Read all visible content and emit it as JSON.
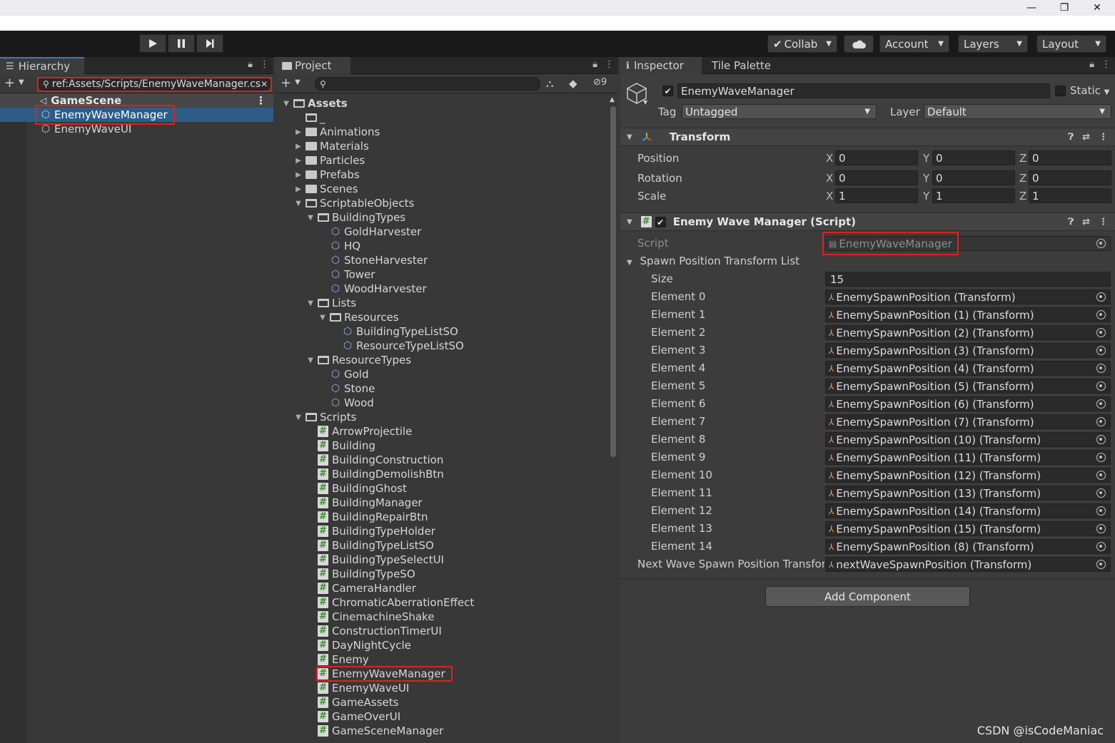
{
  "window": {
    "minimize_glyph": "—",
    "maximize_glyph": "❐",
    "close_glyph": "✕"
  },
  "toolbar": {
    "collab_label": "Collab",
    "account_label": "Account",
    "layers_label": "Layers",
    "layout_label": "Layout"
  },
  "hierarchy": {
    "tab_label": "Hierarchy",
    "search_value": "ref:Assets/Scripts/EnemyWaveManager.cs",
    "scene_name": "GameScene",
    "items": [
      {
        "label": "EnemyWaveManager"
      },
      {
        "label": "EnemyWaveUI"
      }
    ]
  },
  "project": {
    "tab_label": "Project",
    "hidden_count": "9",
    "tree": [
      {
        "label": "Assets",
        "kind": "folder-open",
        "depth": 0,
        "arrow": "down",
        "bold": true
      },
      {
        "label": "_",
        "kind": "folder-open",
        "depth": 1,
        "arrow": ""
      },
      {
        "label": "Animations",
        "kind": "folder",
        "depth": 1,
        "arrow": "right"
      },
      {
        "label": "Materials",
        "kind": "folder",
        "depth": 1,
        "arrow": "right"
      },
      {
        "label": "Particles",
        "kind": "folder",
        "depth": 1,
        "arrow": "right"
      },
      {
        "label": "Prefabs",
        "kind": "folder",
        "depth": 1,
        "arrow": "right"
      },
      {
        "label": "Scenes",
        "kind": "folder",
        "depth": 1,
        "arrow": "right"
      },
      {
        "label": "ScriptableObjects",
        "kind": "folder-open",
        "depth": 1,
        "arrow": "down"
      },
      {
        "label": "BuildingTypes",
        "kind": "folder-open",
        "depth": 2,
        "arrow": "down"
      },
      {
        "label": "GoldHarvester",
        "kind": "so",
        "depth": 3,
        "arrow": ""
      },
      {
        "label": "HQ",
        "kind": "so",
        "depth": 3,
        "arrow": ""
      },
      {
        "label": "StoneHarvester",
        "kind": "so",
        "depth": 3,
        "arrow": ""
      },
      {
        "label": "Tower",
        "kind": "so",
        "depth": 3,
        "arrow": ""
      },
      {
        "label": "WoodHarvester",
        "kind": "so",
        "depth": 3,
        "arrow": ""
      },
      {
        "label": "Lists",
        "kind": "folder-open",
        "depth": 2,
        "arrow": "down"
      },
      {
        "label": "Resources",
        "kind": "folder-open",
        "depth": 3,
        "arrow": "down"
      },
      {
        "label": "BuildingTypeListSO",
        "kind": "so",
        "depth": 4,
        "arrow": ""
      },
      {
        "label": "ResourceTypeListSO",
        "kind": "so",
        "depth": 4,
        "arrow": ""
      },
      {
        "label": "ResourceTypes",
        "kind": "folder-open",
        "depth": 2,
        "arrow": "down"
      },
      {
        "label": "Gold",
        "kind": "so",
        "depth": 3,
        "arrow": ""
      },
      {
        "label": "Stone",
        "kind": "so",
        "depth": 3,
        "arrow": ""
      },
      {
        "label": "Wood",
        "kind": "so",
        "depth": 3,
        "arrow": ""
      },
      {
        "label": "Scripts",
        "kind": "folder-open",
        "depth": 1,
        "arrow": "down"
      },
      {
        "label": "ArrowProjectile",
        "kind": "script",
        "depth": 2,
        "arrow": ""
      },
      {
        "label": "Building",
        "kind": "script",
        "depth": 2,
        "arrow": ""
      },
      {
        "label": "BuildingConstruction",
        "kind": "script",
        "depth": 2,
        "arrow": ""
      },
      {
        "label": "BuildingDemolishBtn",
        "kind": "script",
        "depth": 2,
        "arrow": ""
      },
      {
        "label": "BuildingGhost",
        "kind": "script",
        "depth": 2,
        "arrow": ""
      },
      {
        "label": "BuildingManager",
        "kind": "script",
        "depth": 2,
        "arrow": ""
      },
      {
        "label": "BuildingRepairBtn",
        "kind": "script",
        "depth": 2,
        "arrow": ""
      },
      {
        "label": "BuildingTypeHolder",
        "kind": "script",
        "depth": 2,
        "arrow": ""
      },
      {
        "label": "BuildingTypeListSO",
        "kind": "script",
        "depth": 2,
        "arrow": ""
      },
      {
        "label": "BuildingTypeSelectUI",
        "kind": "script",
        "depth": 2,
        "arrow": ""
      },
      {
        "label": "BuildingTypeSO",
        "kind": "script",
        "depth": 2,
        "arrow": ""
      },
      {
        "label": "CameraHandler",
        "kind": "script",
        "depth": 2,
        "arrow": ""
      },
      {
        "label": "ChromaticAberrationEffect",
        "kind": "script",
        "depth": 2,
        "arrow": ""
      },
      {
        "label": "CinemachineShake",
        "kind": "script",
        "depth": 2,
        "arrow": ""
      },
      {
        "label": "ConstructionTimerUI",
        "kind": "script",
        "depth": 2,
        "arrow": ""
      },
      {
        "label": "DayNightCycle",
        "kind": "script",
        "depth": 2,
        "arrow": ""
      },
      {
        "label": "Enemy",
        "kind": "script",
        "depth": 2,
        "arrow": ""
      },
      {
        "label": "EnemyWaveManager",
        "kind": "script",
        "depth": 2,
        "arrow": "",
        "highlight": true
      },
      {
        "label": "EnemyWaveUI",
        "kind": "script",
        "depth": 2,
        "arrow": ""
      },
      {
        "label": "GameAssets",
        "kind": "script",
        "depth": 2,
        "arrow": ""
      },
      {
        "label": "GameOverUI",
        "kind": "script",
        "depth": 2,
        "arrow": ""
      },
      {
        "label": "GameSceneManager",
        "kind": "script",
        "depth": 2,
        "arrow": ""
      }
    ]
  },
  "inspector": {
    "tab_label": "Inspector",
    "tab2_label": "Tile Palette",
    "object_name": "EnemyWaveManager",
    "static_label": "Static",
    "tag_label": "Tag",
    "tag_value": "Untagged",
    "layer_label": "Layer",
    "layer_value": "Default",
    "transform": {
      "title": "Transform",
      "rows": [
        {
          "label": "Position",
          "x": "0",
          "y": "0",
          "z": "0"
        },
        {
          "label": "Rotation",
          "x": "0",
          "y": "0",
          "z": "0"
        },
        {
          "label": "Scale",
          "x": "1",
          "y": "1",
          "z": "1"
        }
      ]
    },
    "script_component": {
      "title": "Enemy Wave Manager (Script)",
      "script_label": "Script",
      "script_value": "EnemyWaveManager",
      "list_label": "Spawn Position Transform List",
      "size_label": "Size",
      "size_value": "15",
      "elements": [
        {
          "label": "Element 0",
          "value": "EnemySpawnPosition (Transform)"
        },
        {
          "label": "Element 1",
          "value": "EnemySpawnPosition (1) (Transform)"
        },
        {
          "label": "Element 2",
          "value": "EnemySpawnPosition (2) (Transform)"
        },
        {
          "label": "Element 3",
          "value": "EnemySpawnPosition (3) (Transform)"
        },
        {
          "label": "Element 4",
          "value": "EnemySpawnPosition (4) (Transform)"
        },
        {
          "label": "Element 5",
          "value": "EnemySpawnPosition (5) (Transform)"
        },
        {
          "label": "Element 6",
          "value": "EnemySpawnPosition (6) (Transform)"
        },
        {
          "label": "Element 7",
          "value": "EnemySpawnPosition (7) (Transform)"
        },
        {
          "label": "Element 8",
          "value": "EnemySpawnPosition (10) (Transform)"
        },
        {
          "label": "Element 9",
          "value": "EnemySpawnPosition (11) (Transform)"
        },
        {
          "label": "Element 10",
          "value": "EnemySpawnPosition (12) (Transform)"
        },
        {
          "label": "Element 11",
          "value": "EnemySpawnPosition (13) (Transform)"
        },
        {
          "label": "Element 12",
          "value": "EnemySpawnPosition (14) (Transform)"
        },
        {
          "label": "Element 13",
          "value": "EnemySpawnPosition (15) (Transform)"
        },
        {
          "label": "Element 14",
          "value": "EnemySpawnPosition (8) (Transform)"
        }
      ],
      "next_label": "Next Wave Spawn Position Transform",
      "next_value": "nextWaveSpawnPosition (Transform)"
    },
    "add_component_label": "Add Component"
  },
  "watermark": "CSDN @isCodeManiac",
  "colors": {
    "highlight_red": "#e02020",
    "selection_blue": "#2c5d87",
    "tab_accent": "#3a79bb"
  }
}
